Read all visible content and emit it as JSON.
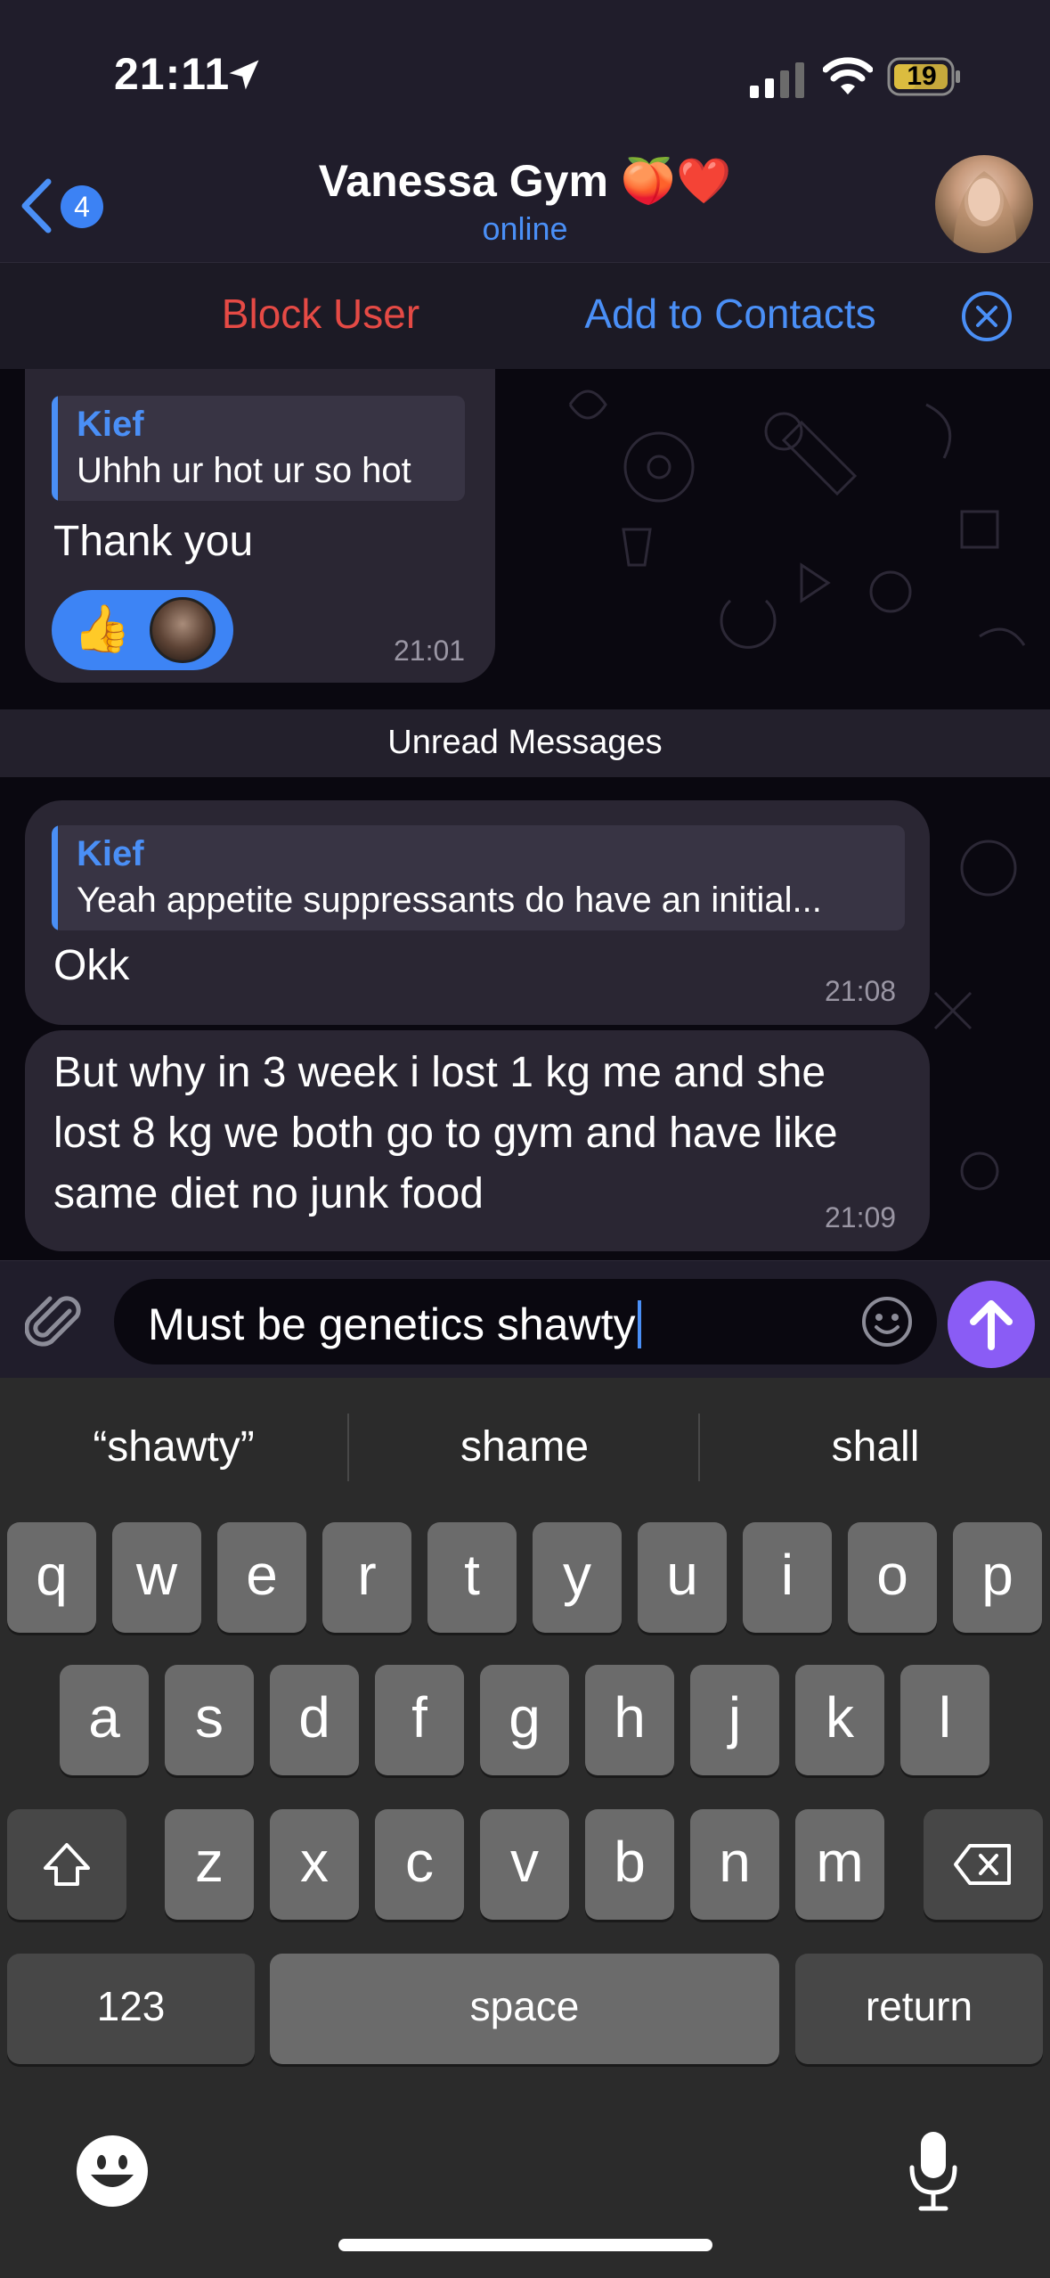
{
  "status_bar": {
    "time": "21:11",
    "battery": "19"
  },
  "header": {
    "back_badge": "4",
    "title": "Vanessa Gym 🍑❤️",
    "status": "online"
  },
  "banner": {
    "block_label": "Block User",
    "add_label": "Add to Contacts"
  },
  "messages": [
    {
      "reply_name": "Kief",
      "reply_text": "Uhhh ur hot ur so hot",
      "text": "Thank you",
      "time": "21:01",
      "reaction_emoji": "👍"
    },
    {
      "reply_name": "Kief",
      "reply_text": "Yeah appetite suppressants do have an initial...",
      "text": "Okk",
      "time": "21:08"
    },
    {
      "lines": [
        "But why in  3 week i lost 1 kg me and she",
        "lost 8 kg we both go to gym and have like",
        "same diet no junk food"
      ],
      "time": "21:09"
    }
  ],
  "unread_label": "Unread Messages",
  "input": {
    "value": "Must be genetics shawty"
  },
  "keyboard": {
    "suggestions": [
      "“shawty”",
      "shame",
      "shall"
    ],
    "row1": [
      "q",
      "w",
      "e",
      "r",
      "t",
      "y",
      "u",
      "i",
      "o",
      "p"
    ],
    "row2": [
      "a",
      "s",
      "d",
      "f",
      "g",
      "h",
      "j",
      "k",
      "l"
    ],
    "row3": [
      "z",
      "x",
      "c",
      "v",
      "b",
      "n",
      "m"
    ],
    "numbers_label": "123",
    "space_label": "space",
    "return_label": "return"
  },
  "colors": {
    "accent_blue": "#4a8ff6",
    "danger_red": "#e54a45",
    "send_purple": "#8a5cf5",
    "bubble": "#2a2633"
  },
  "icons": [
    "location-arrow-icon",
    "signal-icon",
    "wifi-icon",
    "battery-icon",
    "back-chevron-icon",
    "close-circle-icon",
    "paperclip-icon",
    "sticker-icon",
    "send-arrow-icon",
    "shift-icon",
    "backspace-icon",
    "emoji-icon",
    "microphone-icon"
  ]
}
